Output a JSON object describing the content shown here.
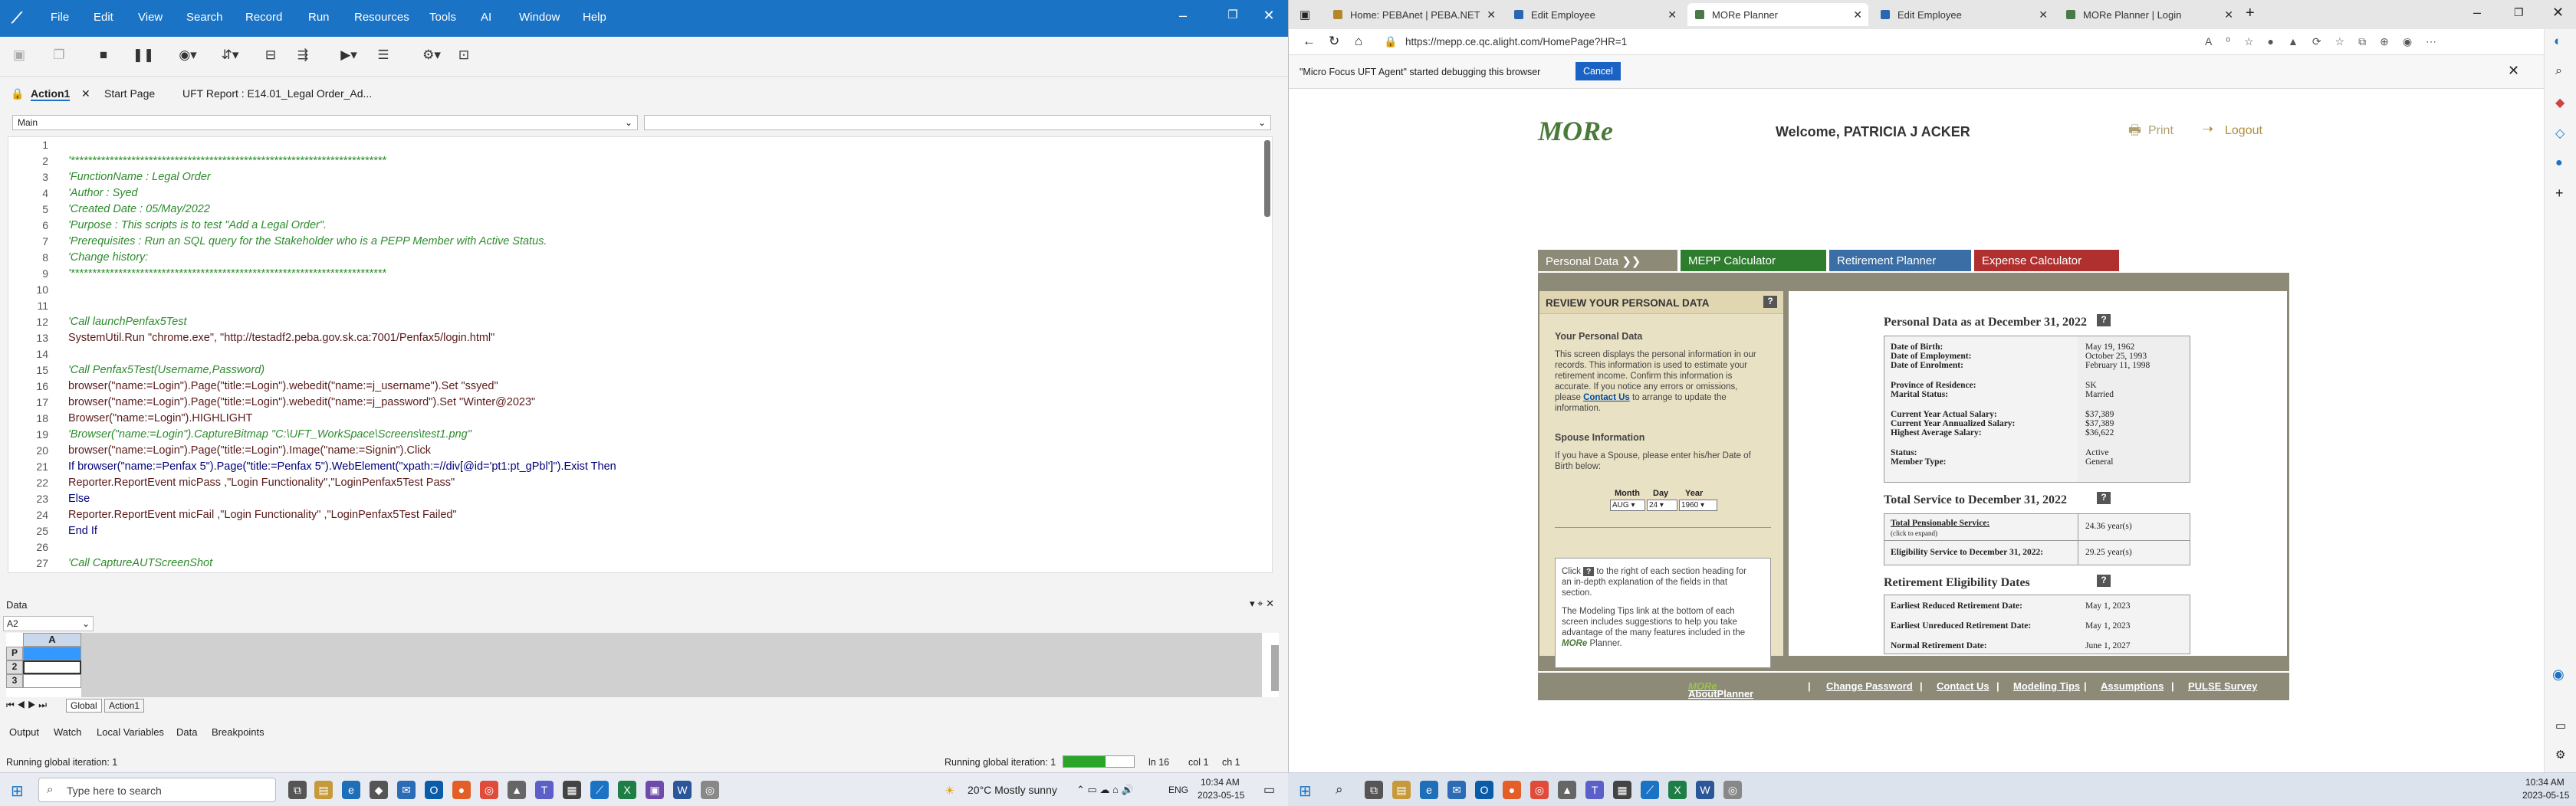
{
  "uft": {
    "menu": [
      "File",
      "Edit",
      "View",
      "Search",
      "Record",
      "Run",
      "Resources",
      "Tools",
      "AI",
      "Window",
      "Help"
    ],
    "tabs": {
      "action": "Action1",
      "start": "Start Page",
      "report": "UFT Report : E14.01_Legal Order_Ad..."
    },
    "combo_main": "Main",
    "lines": [
      {
        "n": "1",
        "t": ""
      },
      {
        "n": "2",
        "t": "'*************************************************************************"
      },
      {
        "n": "3",
        "t": "'FunctionName : Legal Order"
      },
      {
        "n": "4",
        "t": "'Author : Syed"
      },
      {
        "n": "5",
        "t": "'Created Date : 05/May/2022"
      },
      {
        "n": "6",
        "t": "'Purpose : This scripts is to test \"Add a Legal Order\"."
      },
      {
        "n": "7",
        "t": "'Prerequisites : Run an SQL query for the Stakeholder who is a PEPP Member with Active Status."
      },
      {
        "n": "8",
        "t": "'Change history:"
      },
      {
        "n": "9",
        "t": "'*************************************************************************"
      },
      {
        "n": "10",
        "t": ""
      },
      {
        "n": "11",
        "t": ""
      },
      {
        "n": "12",
        "t": "'Call launchPenfax5Test"
      },
      {
        "n": "13",
        "t": "SystemUtil.Run \"chrome.exe\", \"http://testadf2.peba.gov.sk.ca:7001/Penfax5/login.html\""
      },
      {
        "n": "14",
        "t": ""
      },
      {
        "n": "15",
        "t": "'Call Penfax5Test(Username,Password)"
      },
      {
        "n": "16",
        "t": "browser(\"name:=Login\").Page(\"title:=Login\").webedit(\"name:=j_username\").Set \"ssyed\""
      },
      {
        "n": "17",
        "t": "browser(\"name:=Login\").Page(\"title:=Login\").webedit(\"name:=j_password\").Set \"Winter@2023\""
      },
      {
        "n": "18",
        "t": "Browser(\"name:=Login\").HIGHLIGHT"
      },
      {
        "n": "19",
        "t": "'Browser(\"name:=Login\").CaptureBitmap \"C:\\UFT_WorkSpace\\Screens\\test1.png\""
      },
      {
        "n": "20",
        "t": "browser(\"name:=Login\").Page(\"title:=Login\").Image(\"name:=Signin\").Click"
      },
      {
        "n": "21",
        "t": "If browser(\"name:=Penfax 5\").Page(\"title:=Penfax 5\").WebElement(\"xpath:=//div[@id='pt1:pt_gPbl']\").Exist Then"
      },
      {
        "n": "22",
        "t": "Reporter.ReportEvent micPass ,\"Login Functionality\",\"LoginPenfax5Test Pass\""
      },
      {
        "n": "23",
        "t": "Else"
      },
      {
        "n": "24",
        "t": "Reporter.ReportEvent micFail ,\"Login Functionality\" ,\"LoginPenfax5Test Failed\""
      },
      {
        "n": "25",
        "t": "End If"
      },
      {
        "n": "26",
        "t": ""
      },
      {
        "n": "27",
        "t": "'Call CaptureAUTScreenShot"
      }
    ],
    "data_title": "Data",
    "cell_ref": "A2",
    "col_a": "A",
    "rows": [
      "P",
      "2",
      "3"
    ],
    "sheet_global": "Global",
    "sheet_action": "Action1",
    "bottom_tabs": [
      "Output",
      "Watch",
      "Local Variables",
      "Data",
      "Breakpoints"
    ],
    "status_left": "Running global iteration: 1",
    "status_mid": "Running global iteration: 1",
    "progress": 0.6,
    "ln": "ln 16",
    "col": "col 1",
    "ch": "ch 1"
  },
  "taskbar_left": {
    "search": "Type here to search",
    "weather": "20°C  Mostly sunny",
    "lang": "ENG",
    "time": "10:34 AM",
    "date": "2023-05-15"
  },
  "taskbar_right": {
    "time": "10:34 AM",
    "date": "2023-05-15"
  },
  "edge": {
    "tabs": [
      "Home: PEBAnet | PEBA.NET",
      "Edit Employee",
      "MORe Planner",
      "Edit Employee",
      "MORe Planner | Login"
    ],
    "url": "https://mepp.ce.qc.alight.com/HomePage?HR=1",
    "notif": "\"Micro Focus UFT Agent\" started debugging this browser",
    "cancel": "Cancel"
  },
  "more": {
    "logo": "MORe",
    "welcome": "Welcome, PATRICIA J ACKER",
    "print": "Print",
    "logout": "Logout",
    "nav": [
      "Personal Data",
      "MEPP Calculator",
      "Retirement Planner",
      "Expense Calculator"
    ],
    "left_title": "REVIEW YOUR PERSONAL DATA",
    "your_pd": "Your Personal Data",
    "pd_text1": "This screen displays the personal information in our",
    "pd_text2": "records. This information is used to estimate your",
    "pd_text3": "retirement income. Confirm this information is",
    "pd_text4": "accurate. If you notice any errors or omissions,",
    "pd_text5a": "please",
    "pd_contact": "Contact Us",
    "pd_text5b": "to arrange to update the",
    "pd_text6": "information.",
    "spouse_title": "Spouse Information",
    "spouse_text1": "If you have a Spouse, please enter his/her Date of",
    "spouse_text2": "Birth below:",
    "month_lbl": "Month",
    "day_lbl": "Day",
    "year_lbl": "Year",
    "month_val": "AUG",
    "day_val": "24",
    "year_val": "1960",
    "tip1a": "Click",
    "tip1b": "to the right of each section heading for",
    "tip2": "an in-depth explanation of the fields in that",
    "tip3": "section.",
    "tip4": "The Modeling Tips link at the bottom of each",
    "tip5": "screen includes suggestions to help you take",
    "tip6": "advantage of the many features included in the",
    "tip7a": "MORe",
    "tip7b": "Planner.",
    "pd_heading": "Personal Data as at December 31, 2022",
    "pd_rows1": [
      {
        "k": "Date of Birth:",
        "v": "May 19, 1962"
      },
      {
        "k": "Date of Employment:",
        "v": "October 25, 1993"
      },
      {
        "k": "Date of Enrolment:",
        "v": "February 11, 1998"
      }
    ],
    "pd_rows2": [
      {
        "k": "Province of Residence:",
        "v": "SK"
      },
      {
        "k": "Marital Status:",
        "v": "Married"
      }
    ],
    "pd_rows3": [
      {
        "k": "Current Year Actual Salary:",
        "v": "$37,389"
      },
      {
        "k": "Current Year Annualized Salary:",
        "v": "$37,389"
      },
      {
        "k": "Highest Average Salary:",
        "v": "$36,622"
      }
    ],
    "pd_rows4": [
      {
        "k": "Status:",
        "v": "Active"
      },
      {
        "k": "Member Type:",
        "v": "General"
      }
    ],
    "ts_heading": "Total Service to December 31, 2022",
    "ts_k1": "Total Pensionable Service:",
    "ts_k1b": "(click to expand)",
    "ts_v1": "24.36 year(s)",
    "ts_k2": "Eligibility Service to December 31, 2022:",
    "ts_v2": "29.25 year(s)",
    "red_heading": "Retirement Eligibility Dates",
    "red_rows": [
      {
        "k": "Earliest Reduced Retirement Date:",
        "v": "May 1, 2023"
      },
      {
        "k": "Earliest Unreduced Retirement Date:",
        "v": "May 1, 2023"
      },
      {
        "k": "Normal Retirement Date:",
        "v": "June 1, 2027"
      }
    ],
    "footer_about_a": "About the",
    "footer_about_more": "MORe",
    "footer_about_b": "Planner",
    "footer": [
      "Change Password",
      "Contact Us",
      "Modeling Tips",
      "Assumptions",
      "PULSE Survey"
    ]
  },
  "colors": {
    "uft_blue": "#1a73c4",
    "more_gray": "#8d8a78",
    "tab_gray": "#8d8a78",
    "tab_green": "#2e7d2e",
    "tab_blue": "#3a6ea5",
    "tab_red": "#b03030",
    "panel_beige": "#e9e1c4"
  }
}
